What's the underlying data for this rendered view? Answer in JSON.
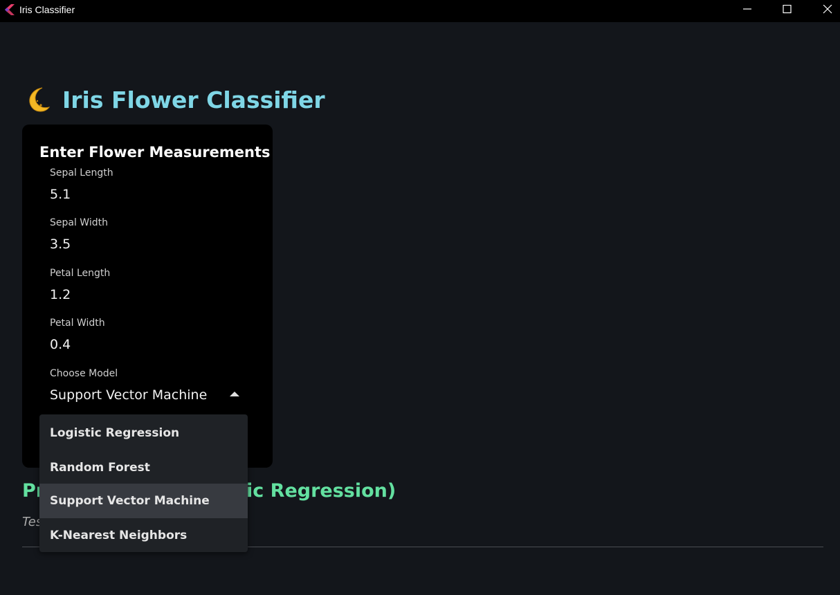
{
  "window": {
    "title": "Iris Classifier"
  },
  "page": {
    "heading": "Iris Flower Classifier",
    "heading_icon": "crescent-moon-icon"
  },
  "form": {
    "title": "Enter Flower Measurements",
    "fields": [
      {
        "label": "Sepal Length",
        "value": "5.1"
      },
      {
        "label": "Sepal Width",
        "value": "3.5"
      },
      {
        "label": "Petal Length",
        "value": "1.2"
      },
      {
        "label": "Petal Width",
        "value": "0.4"
      }
    ],
    "model_select": {
      "label": "Choose Model",
      "value": "Support Vector Machine",
      "options": [
        "Logistic Regression",
        "Random Forest",
        "Support Vector Machine",
        "K-Nearest Neighbors"
      ],
      "selected_index": 2
    }
  },
  "result": {
    "prediction_visible_start": "Pr",
    "prediction_visible_end": "ic Regression)",
    "test_visible": "Tes"
  },
  "colors": {
    "heading": "#7fd6e6",
    "prediction": "#63e0a0",
    "background": "#13161b",
    "card": "#000000",
    "dropdown": "#1f2226",
    "dropdown_selected": "#373a40"
  }
}
